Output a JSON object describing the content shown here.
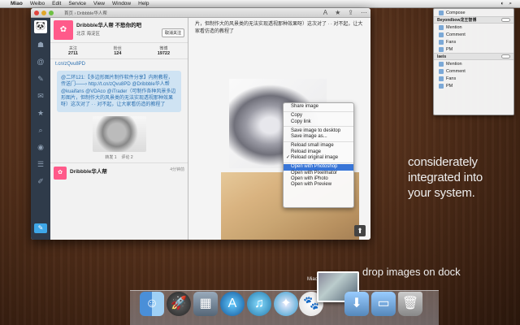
{
  "menubar": {
    "app": "Miao",
    "items": [
      "Weibo",
      "Edit",
      "Service",
      "View",
      "Window",
      "Help"
    ]
  },
  "window": {
    "breadcrumb": "首页 › Dribbble华人帮"
  },
  "profile": {
    "name": "Dribbble华人帮 不愁你的吧",
    "sub": "北京 海淀区",
    "follow": "取消关注",
    "stats": [
      {
        "label": "关注",
        "value": "2711"
      },
      {
        "label": "粉丝",
        "value": "124"
      },
      {
        "label": "微博",
        "value": "19722"
      }
    ]
  },
  "tweet": {
    "link": "t.cn/zQvu8PD",
    "body": "@二环121:【多边形图片制作软件分享】内附教程，传送门——› http://t.cn/zQvu8PD @Dribbble华人帮 @kuaifans @VDAco @iTrader（可制作各种风景多边形图片，但制作大的风景类的无法实现透视那种效果呀）这次对了 ∙ ∙ 对不起，让大家看仿造的教程了",
    "meta": [
      "转发 1",
      "评论 2"
    ],
    "next_name": "Dribbble华人帮",
    "next_time": "4分钟前"
  },
  "detail": {
    "text": "片，但制作大的风景类的无法实现透视那种效果呀）这次对了 ∙ ∙ 对不起，让大家看仿造的教程了"
  },
  "context_menu": {
    "items": [
      "Share image",
      "Copy",
      "Copy link",
      "Save image to desktop",
      "Save image as...",
      "Reload small image",
      "Reload image",
      "Reload original image",
      "Open with Photoshop",
      "Open with Pixelmator",
      "Open with iPhoto",
      "Open with Preview"
    ],
    "selected": "Open with Photoshop",
    "checked": "Reload original image"
  },
  "dropdown": {
    "compose": "Compose",
    "account1": "Beyondbow龙王智博",
    "account2": "laeis",
    "rows1": [
      "Mention",
      "Comment",
      "Fans",
      "PM"
    ],
    "rows2": [
      "Mention",
      "Comment",
      "Fans",
      "PM"
    ]
  },
  "tagline": [
    "considerately",
    "integrated into",
    "your system."
  ],
  "dock_tagline": "drop images on dock",
  "dock_label": "Miao",
  "dock_icons": [
    "finder-icon",
    "launchpad-icon",
    "preview-icon",
    "app-store-icon",
    "itunes-icon",
    "safari-icon",
    "miao-icon",
    "downloads-folder-icon",
    "folder-icon",
    "trash-icon"
  ]
}
